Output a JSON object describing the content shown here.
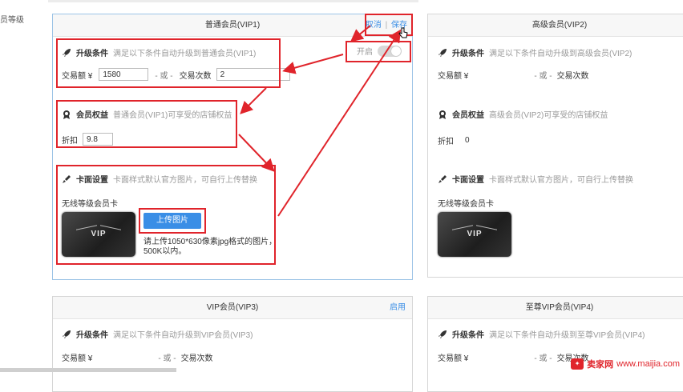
{
  "left_label": "员等级",
  "vip1": {
    "title": "普通会员(VIP1)",
    "cancel": "取消",
    "divider": "|",
    "save": "保存",
    "toggle_label": "开启",
    "upgrade_title": "升级条件",
    "upgrade_desc": "满足以下条件自动升级到普通会员(VIP1)",
    "amount_label": "交易额 ¥",
    "amount_value": "1580",
    "or_text": "- 或 -",
    "count_label": "交易次数",
    "count_value": "2",
    "rights_title": "会员权益",
    "rights_desc": "普通会员(VIP1)可享受的店铺权益",
    "discount_label": "折扣",
    "discount_value": "9.8",
    "card_title": "卡面设置",
    "card_desc": "卡面样式默认官方图片，可自行上传替换",
    "card_name": "无线等级会员卡",
    "card_vip_text": "VIP",
    "upload_button": "上传图片",
    "upload_hint_1": "请上传1050*630像素jpg格式的图片，",
    "upload_hint_2": "500K以内。"
  },
  "vip2": {
    "title": "高级会员(VIP2)",
    "upgrade_title": "升级条件",
    "upgrade_desc": "满足以下条件自动升级到高级会员(VIP2)",
    "amount_label": "交易额 ¥",
    "or_text": "- 或 -",
    "count_label": "交易次数",
    "rights_title": "会员权益",
    "rights_desc": "高级会员(VIP2)可享受的店铺权益",
    "discount_label": "折扣",
    "discount_value": "0",
    "card_title": "卡面设置",
    "card_desc": "卡面样式默认官方图片，可自行上传替换",
    "card_name": "无线等级会员卡",
    "card_vip_text": "VIP"
  },
  "vip3": {
    "title": "VIP会员(VIP3)",
    "enable": "启用",
    "upgrade_title": "升级条件",
    "upgrade_desc": "满足以下条件自动升级到VIP会员(VIP3)",
    "amount_label": "交易额 ¥",
    "or_text": "- 或 -",
    "count_label": "交易次数"
  },
  "vip4": {
    "title": "至尊VIP会员(VIP4)",
    "upgrade_title": "升级条件",
    "upgrade_desc": "满足以下条件自动升级到至尊VIP会员(VIP4)",
    "amount_label": "交易额 ¥",
    "or_text": "- 或 -",
    "count_label": "交易次数"
  },
  "watermark": {
    "brand": "卖家网",
    "url": "www.maijia.com"
  },
  "colors": {
    "annotation_red": "#e0242b",
    "link_blue": "#3a8ee6"
  }
}
